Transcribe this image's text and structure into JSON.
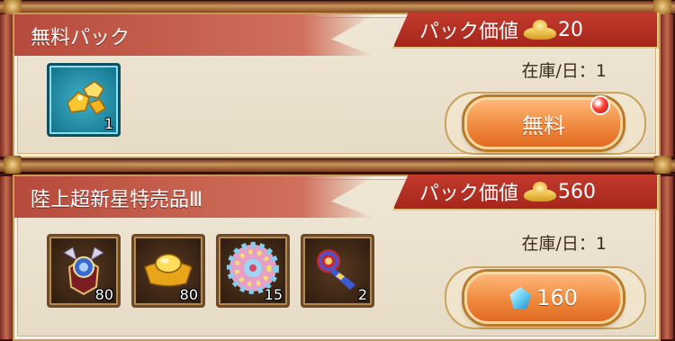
{
  "packs": [
    {
      "title": "無料パック",
      "value_label": "パック価値",
      "value_amount": "20",
      "value_icon": "gold-ingot-icon",
      "stock_text": "在庫/日：1",
      "items": [
        {
          "icon": "gold-nuggets-icon",
          "count": "1"
        }
      ],
      "button_label": "無料",
      "button_icon": "",
      "has_notification": true
    },
    {
      "title": "陸上超新星特売品Ⅲ",
      "value_label": "パック価値",
      "value_amount": "560",
      "value_icon": "gold-ingot-icon",
      "stock_text": "在庫/日：1",
      "items": [
        {
          "icon": "emblem-medal-icon",
          "count": "80"
        },
        {
          "icon": "gold-ingot-icon",
          "count": "80"
        },
        {
          "icon": "confetti-pompom-icon",
          "count": "15"
        },
        {
          "icon": "party-horn-icon",
          "count": "2"
        }
      ],
      "button_label": "160",
      "button_icon": "diamond-icon",
      "has_notification": false
    }
  ],
  "colors": {
    "ribbon": "#c55a48",
    "value_tab": "#b72f22",
    "button": "#f08a3e",
    "card_bg": "#ece3d2"
  }
}
